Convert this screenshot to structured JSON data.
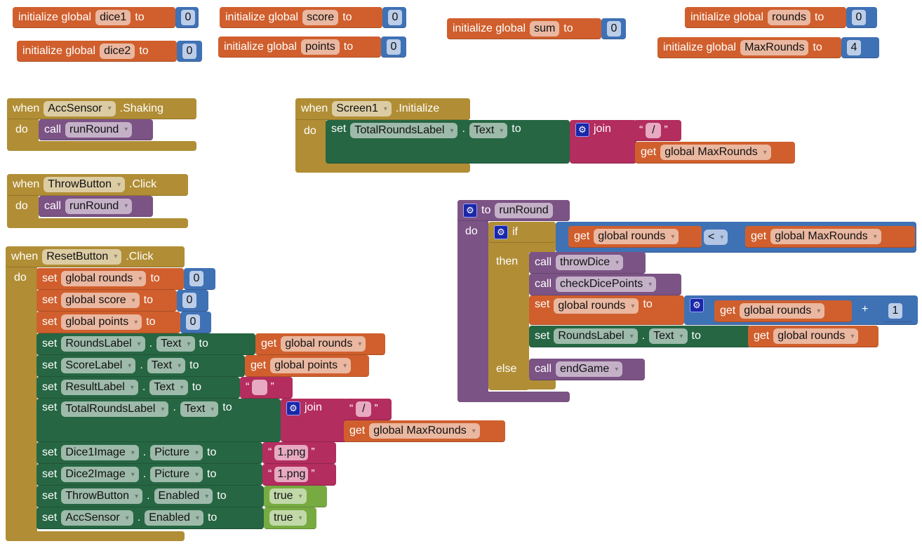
{
  "colors": {
    "event": "#b18e35",
    "variable": "#d05f2d",
    "math": "#3f71b5",
    "procedure": "#7c5385",
    "component": "#266643",
    "text": "#b32d5e",
    "logic": "#77ab41"
  },
  "globals": [
    {
      "label": "initialize global",
      "name": "dice1",
      "to": "to",
      "value": "0"
    },
    {
      "label": "initialize global",
      "name": "dice2",
      "to": "to",
      "value": "0"
    },
    {
      "label": "initialize global",
      "name": "score",
      "to": "to",
      "value": "0"
    },
    {
      "label": "initialize global",
      "name": "points",
      "to": "to",
      "value": "0"
    },
    {
      "label": "initialize global",
      "name": "sum",
      "to": "to",
      "value": "0"
    },
    {
      "label": "initialize global",
      "name": "rounds",
      "to": "to",
      "value": "0"
    },
    {
      "label": "initialize global",
      "name": "MaxRounds",
      "to": "to",
      "value": "4"
    }
  ],
  "events": {
    "acc": {
      "when": "when",
      "component": "AccSensor",
      "event": ".Shaking",
      "do": "do",
      "call": "call",
      "procedure": "runRound"
    },
    "throw": {
      "when": "when",
      "component": "ThrowButton",
      "event": ".Click",
      "do": "do",
      "call": "call",
      "procedure": "runRound"
    },
    "screen": {
      "when": "when",
      "component": "Screen1",
      "event": ".Initialize",
      "do": "do",
      "set": "set",
      "comp": "TotalRoundsLabel",
      "dot": ".",
      "prop": "Text",
      "to": "to",
      "join": "join",
      "text": "/",
      "get": "get",
      "var": "global MaxRounds"
    },
    "reset": {
      "when": "when",
      "component": "ResetButton",
      "event": ".Click",
      "do": "do",
      "s": [
        {
          "set": "set",
          "var": "global rounds",
          "to": "to",
          "value": "0"
        },
        {
          "set": "set",
          "var": "global score",
          "to": "to",
          "value": "0"
        },
        {
          "set": "set",
          "var": "global points",
          "to": "to",
          "value": "0"
        },
        {
          "set": "set",
          "comp": "RoundsLabel",
          "dot": ".",
          "prop": "Text",
          "to": "to",
          "get": "get",
          "var": "global rounds"
        },
        {
          "set": "set",
          "comp": "ScoreLabel",
          "dot": ".",
          "prop": "Text",
          "to": "to",
          "get": "get",
          "var": "global points"
        },
        {
          "set": "set",
          "comp": "ResultLabel",
          "dot": ".",
          "prop": "Text",
          "to": "to",
          "text": ""
        },
        {
          "set": "set",
          "comp": "TotalRoundsLabel",
          "dot": ".",
          "prop": "Text",
          "to": "to",
          "join": "join",
          "text": "/",
          "get": "get",
          "var": "global MaxRounds"
        },
        {
          "set": "set",
          "comp": "Dice1Image",
          "dot": ".",
          "prop": "Picture",
          "to": "to",
          "text": "1.png"
        },
        {
          "set": "set",
          "comp": "Dice2Image",
          "dot": ".",
          "prop": "Picture",
          "to": "to",
          "text": "1.png"
        },
        {
          "set": "set",
          "comp": "ThrowButton",
          "dot": ".",
          "prop": "Enabled",
          "to": "to",
          "value": "true"
        },
        {
          "set": "set",
          "comp": "AccSensor",
          "dot": ".",
          "prop": "Enabled",
          "to": "to",
          "value": "true"
        }
      ]
    }
  },
  "procedure": {
    "to": "to",
    "name": "runRound",
    "do": "do",
    "if": {
      "if": "if",
      "then": "then",
      "else": "else",
      "cond": {
        "get": "get",
        "left": "global rounds",
        "op": "<",
        "get2": "get",
        "right": "global MaxRounds"
      },
      "then_s": [
        {
          "call": "call",
          "procedure": "throwDice"
        },
        {
          "call": "call",
          "procedure": "checkDicePoints"
        },
        {
          "set": "set",
          "var": "global rounds",
          "to": "to",
          "get": "get",
          "operand": "global rounds",
          "op": "+",
          "value": "1"
        },
        {
          "set": "set",
          "comp": "RoundsLabel",
          "dot": ".",
          "prop": "Text",
          "to": "to",
          "get": "get",
          "var": "global rounds"
        }
      ],
      "else_s": [
        {
          "call": "call",
          "procedure": "endGame"
        }
      ]
    }
  }
}
